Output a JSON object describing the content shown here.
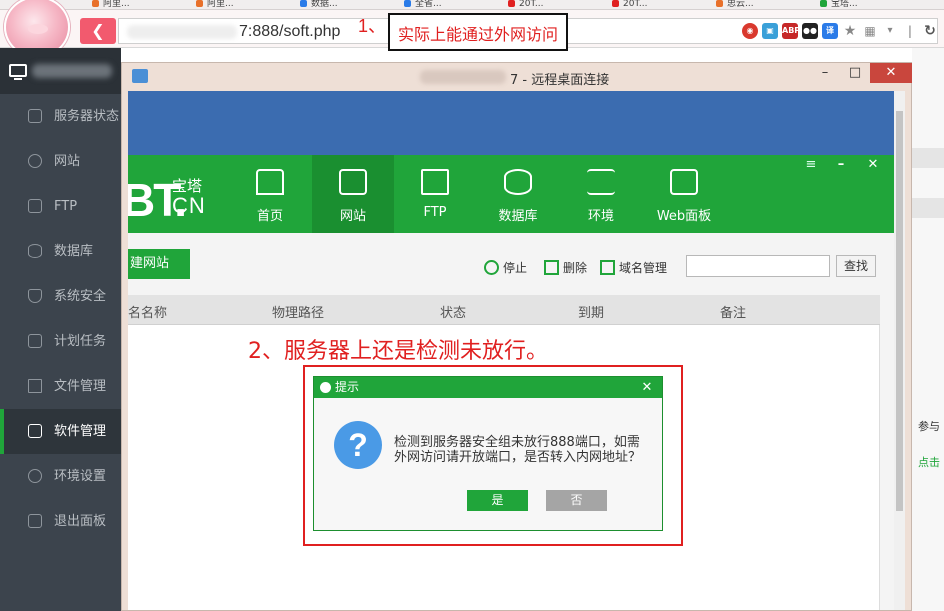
{
  "browser": {
    "url": "7:888/soft.php",
    "tabs": [
      "阿里...",
      "阿里...",
      "数据...",
      "全省...",
      "20T...",
      "20T...",
      "思云...",
      "宝塔..."
    ]
  },
  "annotations": {
    "one_number": "1、",
    "one_text": "实际上能通过外网访问",
    "two_text": "2、服务器上还是检测未放行。"
  },
  "sidebar": {
    "items": [
      {
        "label": "服务器状态",
        "icon": "home-icon"
      },
      {
        "label": "网站",
        "icon": "globe-icon"
      },
      {
        "label": "FTP",
        "icon": "ftp-icon"
      },
      {
        "label": "数据库",
        "icon": "database-icon"
      },
      {
        "label": "系统安全",
        "icon": "shield-icon"
      },
      {
        "label": "计划任务",
        "icon": "calendar-icon"
      },
      {
        "label": "文件管理",
        "icon": "folder-icon"
      },
      {
        "label": "软件管理",
        "icon": "grid-icon",
        "active": true
      },
      {
        "label": "环境设置",
        "icon": "gear-icon"
      },
      {
        "label": "退出面板",
        "icon": "logout-icon"
      }
    ]
  },
  "right_page": {
    "text1": "参与",
    "text2": "点击"
  },
  "rdp": {
    "title": "7 - 远程桌面连接",
    "minimize": "–",
    "maximize": "□",
    "close": "✕"
  },
  "bt": {
    "logo_big": "BT.",
    "logo_small": "宝塔",
    "logo_cn": "CN",
    "nav": [
      "首页",
      "网站",
      "FTP",
      "数据库",
      "环境",
      "Web面板"
    ],
    "nav_active": "网站",
    "win_menu": "≡",
    "win_min": "–",
    "win_close": "✕",
    "new_site": "建网站",
    "tools": {
      "stop": "停止",
      "delete": "删除",
      "domain": "域名管理"
    },
    "search_button": "查找",
    "table_headers": [
      "名名称",
      "物理路径",
      "状态",
      "到期",
      "备注"
    ]
  },
  "dialog": {
    "title": "提示",
    "close": "✕",
    "icon": "question-icon",
    "message": "检测到服务器安全组未放行888端口，如需外网访问请开放端口，是否转入内网地址？",
    "yes": "是",
    "no": "否"
  },
  "colors": {
    "bt_green": "#20a53a",
    "annotation_red": "#e02020",
    "rdp_blue": "#3b6cb0",
    "sidebar": "#3c444d"
  }
}
